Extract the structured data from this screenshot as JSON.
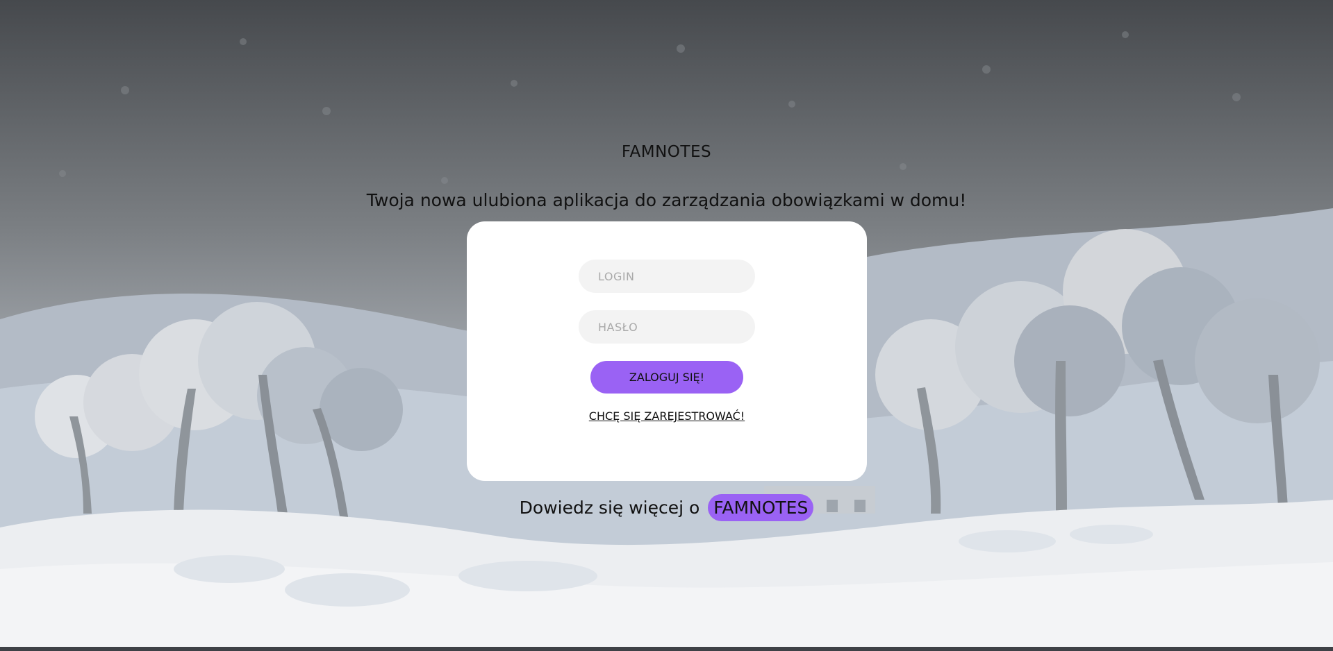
{
  "header": {
    "title": "FAMNOTES",
    "tagline": "Twoja nowa ulubiona aplikacja do zarządzania obowiązkami w domu!"
  },
  "login_form": {
    "login_placeholder": "LOGIN",
    "login_value": "",
    "password_placeholder": "HASŁO",
    "password_value": "",
    "submit_label": "ZALOGUJ SIĘ!",
    "register_link": "CHCĘ SIĘ ZAREJESTROWAĆ!"
  },
  "footer": {
    "learn_more_text": "Dowiedz się więcej o",
    "learn_more_link": "FAMNOTES"
  },
  "colors": {
    "accent": "#9a62f4",
    "card": "#ffffff",
    "field": "#f3f3f3"
  }
}
